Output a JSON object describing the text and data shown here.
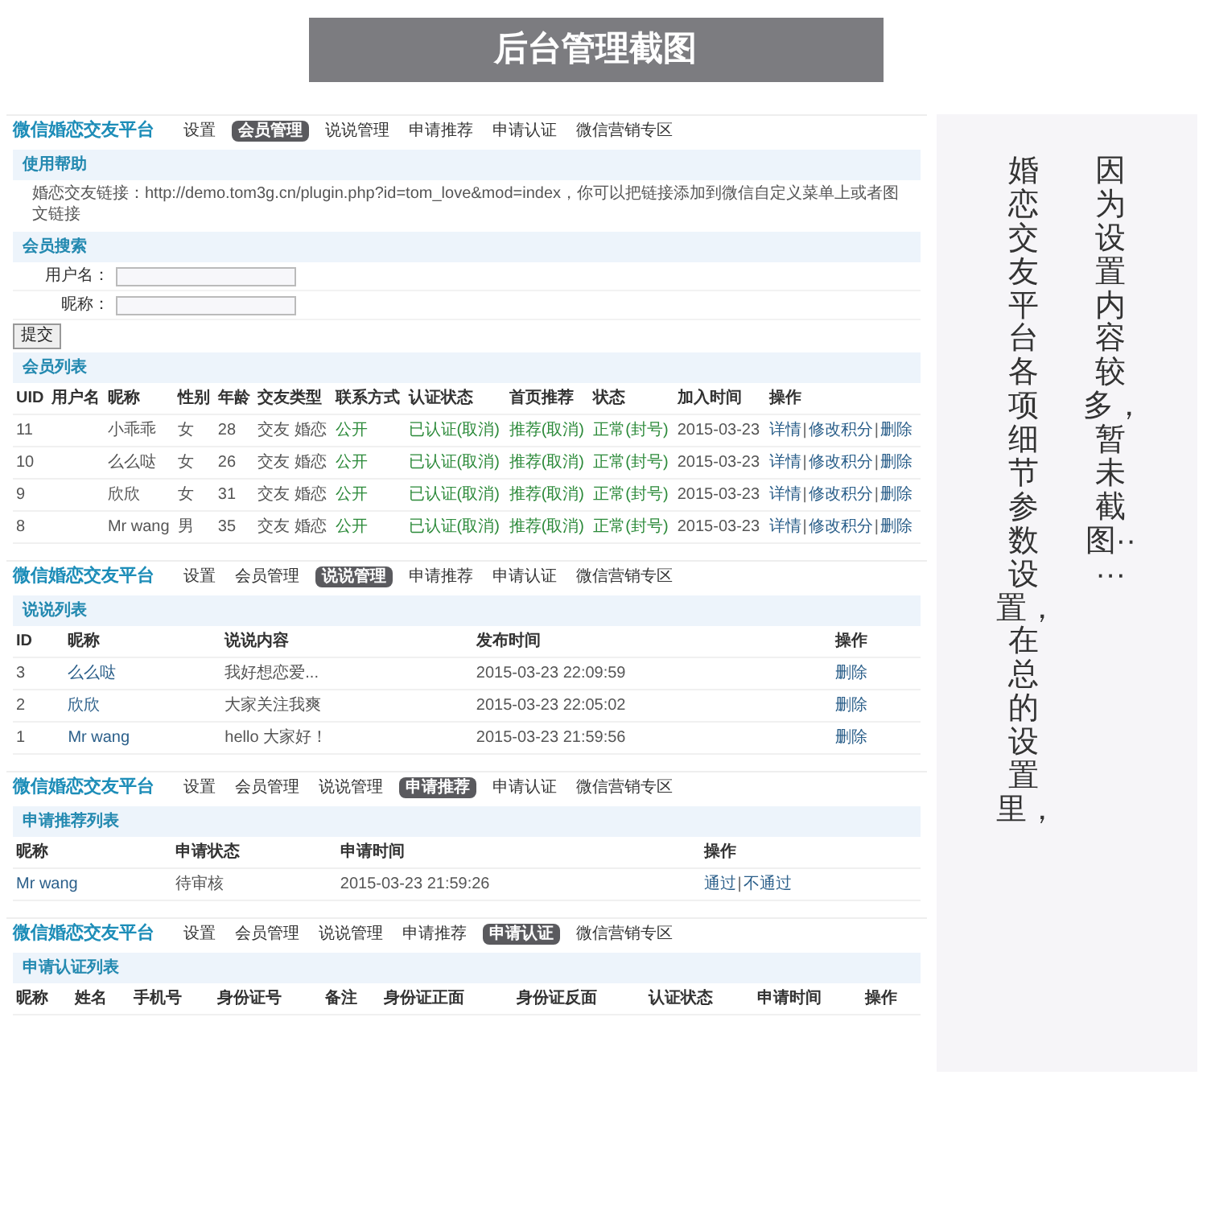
{
  "title": "后台管理截图",
  "screens": [
    {
      "brand": "微信婚恋交友平台",
      "tabs": [
        {
          "label": "设置",
          "selected": false
        },
        {
          "label": "会员管理",
          "selected": true
        },
        {
          "label": "说说管理",
          "selected": false
        },
        {
          "label": "申请推荐",
          "selected": false
        },
        {
          "label": "申请认证",
          "selected": false
        },
        {
          "label": "微信营销专区",
          "selected": false
        }
      ],
      "panels": [
        {
          "kind": "help",
          "header": "使用帮助",
          "items": [
            "婚恋交友链接：http://demo.tom3g.cn/plugin.php?id=tom_love&mod=index，你可以把链接添加到微信自定义菜单上或者图文链接"
          ]
        },
        {
          "kind": "search",
          "header": "会员搜索",
          "fields": [
            "用户名：",
            "昵称："
          ],
          "button": "提交"
        },
        {
          "kind": "table",
          "header": "会员列表",
          "separator": "|",
          "columns": [
            {
              "label": "UID",
              "kind": "text"
            },
            {
              "label": "用户名",
              "kind": "text"
            },
            {
              "label": "昵称",
              "kind": "text"
            },
            {
              "label": "性别",
              "kind": "text"
            },
            {
              "label": "年龄",
              "kind": "text"
            },
            {
              "label": "交友类型",
              "kind": "text"
            },
            {
              "label": "联系方式",
              "kind": "status"
            },
            {
              "label": "认证状态",
              "kind": "status"
            },
            {
              "label": "首页推荐",
              "kind": "status"
            },
            {
              "label": "状态",
              "kind": "status"
            },
            {
              "label": "加入时间",
              "kind": "text"
            },
            {
              "label": "操作",
              "kind": "actions"
            }
          ],
          "rows": [
            [
              "11",
              "",
              "小乖乖",
              "女",
              "28",
              "交友 婚恋",
              "公开",
              "已认证(取消)",
              "推荐(取消)",
              "正常(封号)",
              "2015-03-23",
              [
                "详情",
                "修改积分",
                "删除"
              ]
            ],
            [
              "10",
              "",
              "么么哒",
              "女",
              "26",
              "交友 婚恋",
              "公开",
              "已认证(取消)",
              "推荐(取消)",
              "正常(封号)",
              "2015-03-23",
              [
                "详情",
                "修改积分",
                "删除"
              ]
            ],
            [
              "9",
              "",
              "欣欣",
              "女",
              "31",
              "交友 婚恋",
              "公开",
              "已认证(取消)",
              "推荐(取消)",
              "正常(封号)",
              "2015-03-23",
              [
                "详情",
                "修改积分",
                "删除"
              ]
            ],
            [
              "8",
              "",
              "Mr wang",
              "男",
              "35",
              "交友 婚恋",
              "公开",
              "已认证(取消)",
              "推荐(取消)",
              "正常(封号)",
              "2015-03-23",
              [
                "详情",
                "修改积分",
                "删除"
              ]
            ]
          ]
        }
      ]
    },
    {
      "brand": "微信婚恋交友平台",
      "tabs": [
        {
          "label": "设置",
          "selected": false
        },
        {
          "label": "会员管理",
          "selected": false
        },
        {
          "label": "说说管理",
          "selected": true
        },
        {
          "label": "申请推荐",
          "selected": false
        },
        {
          "label": "申请认证",
          "selected": false
        },
        {
          "label": "微信营销专区",
          "selected": false
        }
      ],
      "panels": [
        {
          "kind": "table",
          "header": "说说列表",
          "columns": [
            {
              "label": "ID",
              "kind": "text"
            },
            {
              "label": "昵称",
              "kind": "link"
            },
            {
              "label": "说说内容",
              "kind": "text"
            },
            {
              "label": "发布时间",
              "kind": "text"
            },
            {
              "label": "操作",
              "kind": "actions"
            }
          ],
          "rows": [
            [
              "3",
              "么么哒",
              "我好想恋爱...",
              "2015-03-23 22:09:59",
              [
                "删除"
              ]
            ],
            [
              "2",
              "欣欣",
              "大家关注我爽",
              "2015-03-23 22:05:02",
              [
                "删除"
              ]
            ],
            [
              "1",
              "Mr wang",
              "hello 大家好！",
              "2015-03-23 21:59:56",
              [
                "删除"
              ]
            ]
          ]
        }
      ]
    },
    {
      "brand": "微信婚恋交友平台",
      "tabs": [
        {
          "label": "设置",
          "selected": false
        },
        {
          "label": "会员管理",
          "selected": false
        },
        {
          "label": "说说管理",
          "selected": false
        },
        {
          "label": "申请推荐",
          "selected": true
        },
        {
          "label": "申请认证",
          "selected": false
        },
        {
          "label": "微信营销专区",
          "selected": false
        }
      ],
      "panels": [
        {
          "kind": "table",
          "header": "申请推荐列表",
          "separator": "|",
          "columns": [
            {
              "label": "昵称",
              "kind": "link"
            },
            {
              "label": "申请状态",
              "kind": "text"
            },
            {
              "label": "申请时间",
              "kind": "text"
            },
            {
              "label": "操作",
              "kind": "actions"
            }
          ],
          "rows": [
            [
              "Mr wang",
              "待审核",
              "2015-03-23 21:59:26",
              [
                "通过",
                "不通过"
              ]
            ]
          ]
        }
      ]
    },
    {
      "brand": "微信婚恋交友平台",
      "tabs": [
        {
          "label": "设置",
          "selected": false
        },
        {
          "label": "会员管理",
          "selected": false
        },
        {
          "label": "说说管理",
          "selected": false
        },
        {
          "label": "申请推荐",
          "selected": false
        },
        {
          "label": "申请认证",
          "selected": true
        },
        {
          "label": "微信营销专区",
          "selected": false
        }
      ],
      "panels": [
        {
          "kind": "table",
          "header": "申请认证列表",
          "columns": [
            {
              "label": "昵称"
            },
            {
              "label": "姓名"
            },
            {
              "label": "手机号"
            },
            {
              "label": "身份证号"
            },
            {
              "label": "备注"
            },
            {
              "label": "身份证正面"
            },
            {
              "label": "身份证反面"
            },
            {
              "label": "认证状态"
            },
            {
              "label": "申请时间"
            },
            {
              "label": "操作"
            }
          ]
        }
      ]
    }
  ],
  "note": {
    "columns": [
      "婚恋交友平台各项细节参数设置，在总的设置里，",
      "因为设置内容较多，暂未截图·····"
    ]
  }
}
